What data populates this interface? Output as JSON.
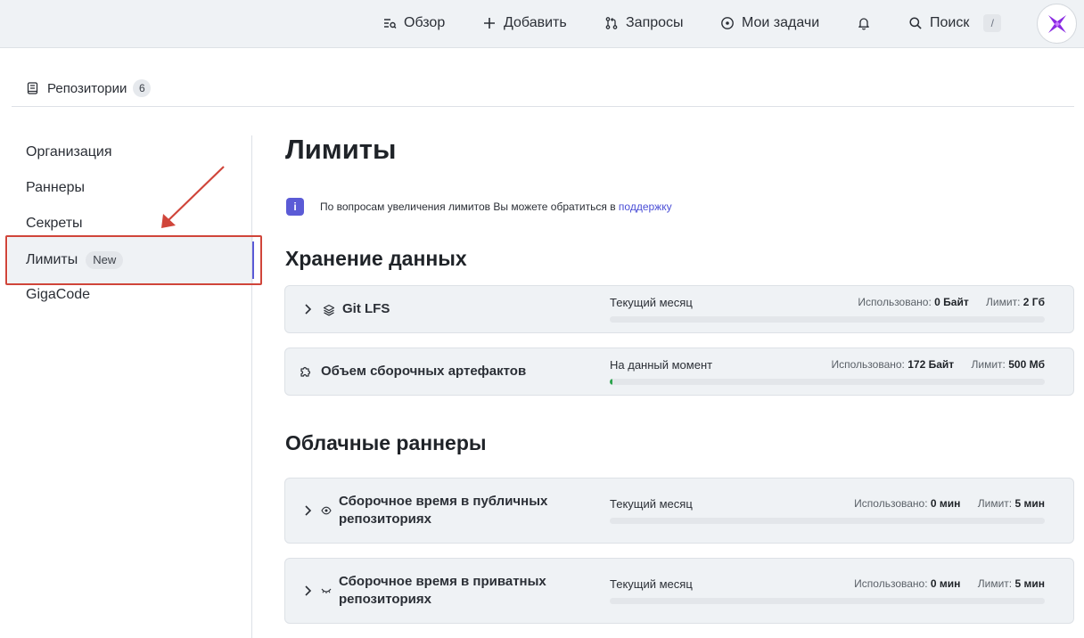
{
  "topnav": {
    "overview": "Обзор",
    "add": "Добавить",
    "requests": "Запросы",
    "my_tasks": "Мои задачи",
    "search": "Поиск",
    "search_shortcut": "/"
  },
  "repo_tab": {
    "label": "Репозитории",
    "count": "6"
  },
  "sidebar": {
    "items": [
      {
        "label": "Организация"
      },
      {
        "label": "Раннеры"
      },
      {
        "label": "Секреты"
      },
      {
        "label": "Лимиты",
        "badge": "New",
        "active": true
      },
      {
        "label": "GigaCode"
      }
    ]
  },
  "main": {
    "title": "Лимиты",
    "info_text": "По вопросам увеличения лимитов Вы можете обратиться в",
    "info_link": "поддержку",
    "sections": [
      {
        "title": "Хранение данных",
        "cards": [
          {
            "title": "Git LFS",
            "period": "Текущий месяц",
            "used_label": "Использовано:",
            "used": "0 Байт",
            "limit_label": "Лимит:",
            "limit": "2 Гб",
            "progress": 0
          },
          {
            "title": "Объем сборочных артефактов",
            "period": "На данный момент",
            "used_label": "Использовано:",
            "used": "172 Байт",
            "limit_label": "Лимит:",
            "limit": "500 Мб",
            "progress": 0.003
          }
        ]
      },
      {
        "title": "Облачные раннеры",
        "cards": [
          {
            "title_line1": "Сборочное время в публичных",
            "title_line2": "репозиториях",
            "period": "Текущий месяц",
            "used_label": "Использовано:",
            "used": "0 мин",
            "limit_label": "Лимит:",
            "limit": "5 мин",
            "progress": 0
          },
          {
            "title_line1": "Сборочное время в приватных",
            "title_line2": "репозиториях",
            "period": "Текущий месяц",
            "used_label": "Использовано:",
            "used": "0 мин",
            "limit_label": "Лимит:",
            "limit": "5 мин",
            "progress": 0
          }
        ]
      }
    ]
  },
  "colors": {
    "accent": "#5b5bd6",
    "highlight": "#d0453a",
    "progress": "#2da44e"
  },
  "icons": [
    "overview-icon",
    "plus-icon",
    "pull-request-icon",
    "tasks-icon",
    "bell-icon",
    "search-icon",
    "repo-icon",
    "info-icon",
    "chevron-right-icon",
    "layers-icon",
    "puzzle-icon",
    "eye-icon",
    "eye-closed-icon",
    "logo-icon",
    "arrow-annotation"
  ]
}
